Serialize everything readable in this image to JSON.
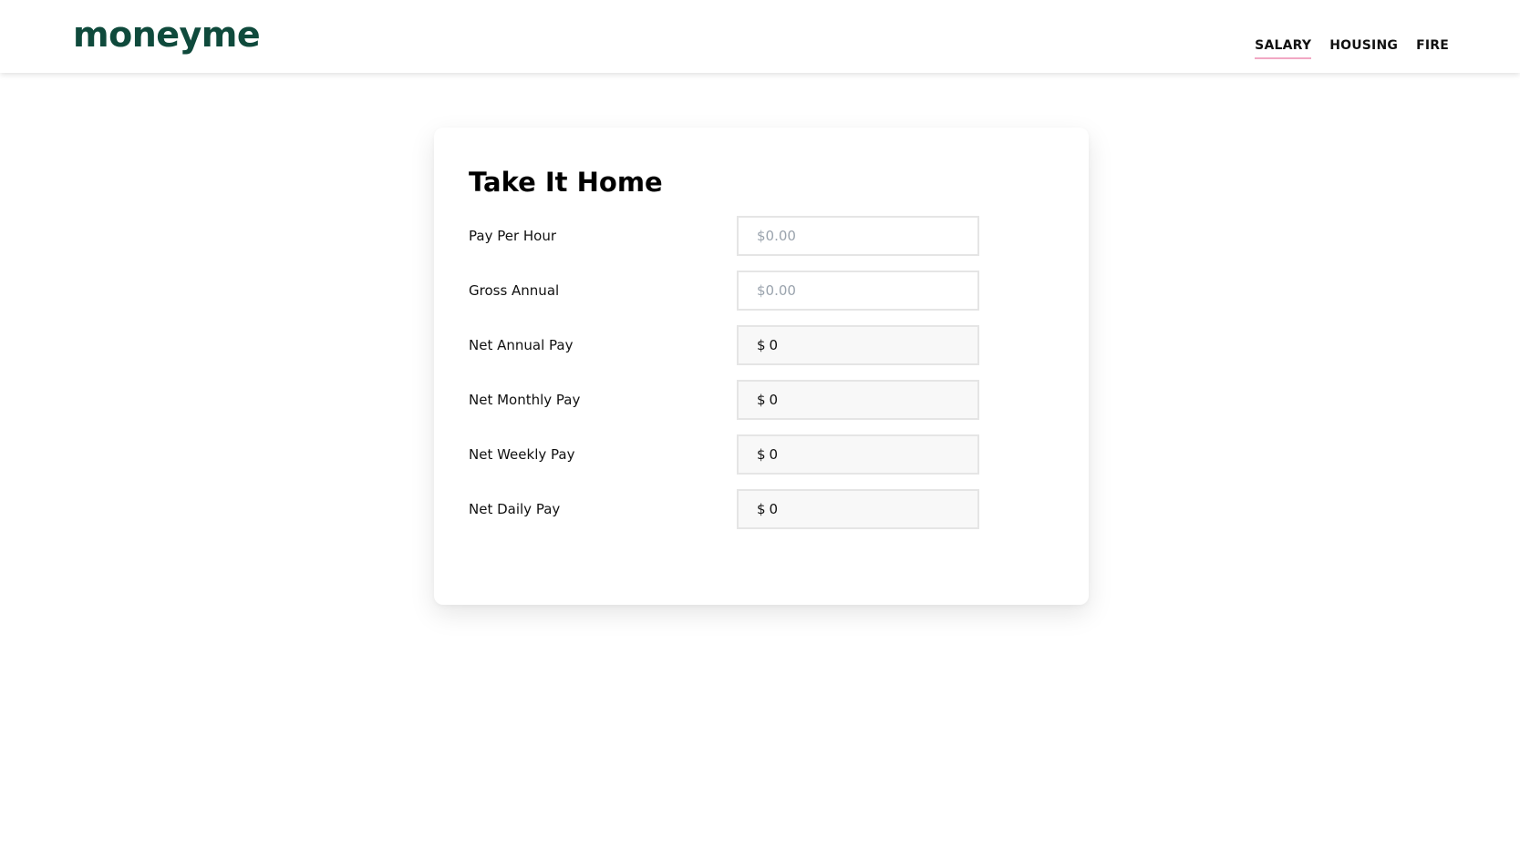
{
  "header": {
    "logo": "moneyme",
    "nav": [
      {
        "label": "SALARY",
        "active": true
      },
      {
        "label": "HOUSING",
        "active": false
      },
      {
        "label": "FIRE",
        "active": false
      }
    ],
    "accent_underline": "#f1a8c4",
    "logo_color": "#0f4a3c"
  },
  "card": {
    "title": "Take It Home",
    "inputs": [
      {
        "label": "Pay Per Hour",
        "placeholder": "$0.00",
        "value": ""
      },
      {
        "label": "Gross Annual",
        "placeholder": "$0.00",
        "value": ""
      }
    ],
    "outputs": [
      {
        "label": "Net Annual Pay",
        "currency": "$",
        "value": "0"
      },
      {
        "label": "Net Monthly Pay",
        "currency": "$",
        "value": "0"
      },
      {
        "label": "Net Weekly Pay",
        "currency": "$",
        "value": "0"
      },
      {
        "label": "Net Daily Pay",
        "currency": "$",
        "value": "0"
      }
    ]
  }
}
